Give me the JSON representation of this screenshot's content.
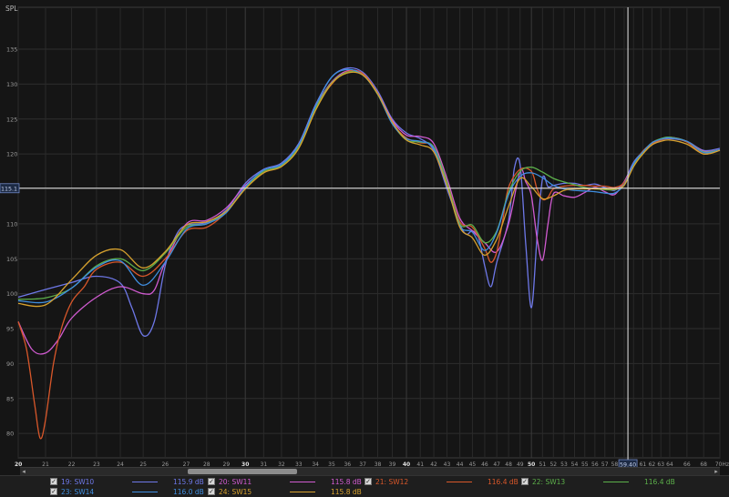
{
  "chart_data": {
    "type": "line",
    "ylabel": "SPL",
    "xunit": "Hz",
    "ylim": [
      76.5,
      141
    ],
    "xlim": [
      20,
      70
    ],
    "x_scale": "log",
    "yticks": [
      80,
      85,
      90,
      95,
      100,
      105,
      110,
      115,
      120,
      125,
      130,
      135
    ],
    "xticks": [
      20,
      21,
      22,
      23,
      24,
      25,
      26,
      27,
      28,
      29,
      30,
      31,
      32,
      33,
      34,
      35,
      36,
      37,
      38,
      39,
      40,
      41,
      42,
      43,
      44,
      45,
      46,
      47,
      48,
      49,
      50,
      51,
      52,
      53,
      54,
      55,
      56,
      57,
      58,
      59,
      60,
      61,
      62,
      63,
      64,
      66,
      68,
      70
    ],
    "xtick_labels": [
      "20",
      "21",
      "22",
      "23",
      "24",
      "25",
      "26",
      "27",
      "28",
      "29",
      "30",
      "31",
      "32",
      "33",
      "34",
      "35",
      "36",
      "37",
      "38",
      "39",
      "40",
      "41",
      "42",
      "43",
      "44",
      "45",
      "46",
      "47",
      "48",
      "49",
      "50",
      "51",
      "52",
      "53",
      "54",
      "55",
      "56",
      "57",
      "58",
      "59",
      "60",
      "61",
      "62",
      "63",
      "64",
      "66",
      "68",
      "70Hz"
    ],
    "grid": true,
    "cursor": {
      "x": 59.4,
      "y": 115.1,
      "x_label": "59.40",
      "y_label": "115.1"
    },
    "series": [
      {
        "name": "19: SW10",
        "level": "115.9 dB",
        "color": "#6e78e8",
        "x": [
          20,
          21,
          22,
          23,
          24,
          24.5,
          25,
          25.5,
          26,
          26.5,
          27,
          28,
          29,
          30,
          31,
          32,
          33,
          34,
          35,
          36,
          37,
          38,
          39,
          40,
          41,
          42,
          43,
          44,
          44.5,
          45,
          45.5,
          46,
          46.5,
          47,
          48,
          48.5,
          49,
          49.5,
          50,
          50.5,
          51,
          51.5,
          52,
          53,
          54,
          55,
          56,
          57,
          58,
          59,
          60,
          61,
          62,
          63,
          64,
          66,
          68,
          70
        ],
        "y": [
          99.5,
          100.6,
          101.6,
          102.5,
          101.5,
          98,
          94,
          96,
          104,
          108.3,
          109.8,
          110.2,
          112,
          115.8,
          117.8,
          118.7,
          121.5,
          127,
          131,
          132.3,
          131.7,
          129,
          125,
          123,
          122.2,
          120.5,
          115,
          110,
          108.5,
          109,
          108,
          104,
          101,
          104.5,
          110.5,
          118,
          118.4,
          107,
          98,
          108,
          116.5,
          115.3,
          115.5,
          115.8,
          115.8,
          115.5,
          115.7,
          115.2,
          114.8,
          116,
          118.8,
          120.3,
          121.3,
          122,
          122.2,
          121.8,
          120.5,
          120.8
        ]
      },
      {
        "name": "20: SW11",
        "level": "115.8 dB",
        "color": "#d15bd1",
        "x": [
          20,
          20.5,
          21,
          21.5,
          22,
          23,
          24,
          25,
          25.5,
          26,
          27,
          28,
          29,
          30,
          31,
          32,
          33,
          34,
          35,
          36,
          37,
          38,
          39,
          40,
          41,
          42,
          43,
          44,
          45,
          46,
          47,
          48,
          49,
          49.5,
          50,
          50.5,
          51,
          51.5,
          52,
          53,
          54,
          55,
          56,
          57,
          58,
          59,
          60,
          61,
          62,
          63,
          64,
          66,
          68,
          70
        ],
        "y": [
          96,
          92,
          91.5,
          93.5,
          96.5,
          99.5,
          101,
          100,
          100.5,
          104.5,
          110,
          110.5,
          112.3,
          115.5,
          117.5,
          118.4,
          121.3,
          126.7,
          130.3,
          131.9,
          131.5,
          128.7,
          124.8,
          122.7,
          122.5,
          121.5,
          116.5,
          110.8,
          109,
          107.3,
          106,
          110,
          117.5,
          116,
          114,
          108,
          104.8,
          110,
          114.3,
          114,
          113.8,
          114.5,
          115.2,
          114.6,
          114.2,
          116,
          118.5,
          120.1,
          121.6,
          122.1,
          122.4,
          121.8,
          120.4,
          120.6
        ]
      },
      {
        "name": "21: SW12",
        "level": "116.4 dB",
        "color": "#d8572a",
        "x": [
          20,
          20.3,
          20.6,
          20.8,
          21,
          21.3,
          21.6,
          22,
          22.5,
          23,
          24,
          25,
          26,
          27,
          28,
          29,
          30,
          31,
          32,
          33,
          34,
          35,
          36,
          37,
          38,
          39,
          40,
          41,
          42,
          43,
          44,
          45,
          46,
          46.5,
          47,
          47.5,
          48,
          49,
          50,
          50.5,
          51,
          51.5,
          52,
          53,
          54,
          55,
          56,
          57,
          58,
          59,
          60,
          61,
          62,
          63,
          64,
          66,
          68,
          70
        ],
        "y": [
          96,
          92,
          84,
          79.3,
          82,
          90,
          95,
          98.8,
          101,
          103.5,
          104.5,
          102.5,
          105,
          109,
          109.5,
          111.7,
          115.2,
          117.4,
          118.2,
          121,
          126.4,
          130,
          131.8,
          131.5,
          128.7,
          124.4,
          122.3,
          121.6,
          121,
          116,
          110.3,
          109.5,
          106.5,
          104.5,
          106,
          110.5,
          115.2,
          117.8,
          117.5,
          115,
          113.5,
          113.8,
          115,
          115.4,
          115.5,
          115.5,
          115.4,
          115.4,
          115.2,
          115.9,
          118.5,
          120.4,
          121.5,
          122,
          122.3,
          121.7,
          120,
          120.6
        ]
      },
      {
        "name": "22: SW13",
        "level": "116.4 dB",
        "color": "#5caf4a",
        "x": [
          20,
          21,
          22,
          23,
          24,
          25,
          26,
          27,
          28,
          29,
          30,
          31,
          32,
          33,
          34,
          35,
          36,
          37,
          38,
          39,
          40,
          41,
          42,
          43,
          44,
          45,
          46,
          47,
          48,
          49,
          50,
          51,
          52,
          53,
          54,
          55,
          56,
          57,
          58,
          59,
          60,
          61,
          62,
          63,
          64,
          66,
          68,
          70
        ],
        "y": [
          99.2,
          99.4,
          100.8,
          104,
          105,
          103.3,
          105.8,
          109.5,
          110,
          111.8,
          115.2,
          117.5,
          118.3,
          121,
          126.5,
          130.2,
          131.7,
          131.3,
          128.5,
          124.4,
          122,
          121.7,
          121,
          116,
          110,
          109.8,
          107.3,
          109,
          114.5,
          117.5,
          118.1,
          117.4,
          116.5,
          116,
          115.6,
          115.2,
          115,
          114.9,
          114.9,
          115.6,
          118.3,
          120.2,
          121.6,
          122.2,
          122.4,
          121.8,
          120.3,
          120.6
        ]
      },
      {
        "name": "23: SW14",
        "level": "116.0 dB",
        "color": "#3f8ee0",
        "x": [
          20,
          21,
          22,
          23,
          24,
          25,
          26,
          27,
          28,
          29,
          30,
          31,
          32,
          33,
          34,
          35,
          36,
          37,
          38,
          39,
          40,
          41,
          42,
          43,
          44,
          45,
          46,
          47,
          48,
          49,
          50,
          51,
          52,
          53,
          54,
          55,
          56,
          57,
          58,
          59,
          60,
          61,
          62,
          63,
          64,
          66,
          68,
          70
        ],
        "y": [
          99,
          98.8,
          100.8,
          103.8,
          104.7,
          101.2,
          104.5,
          109.2,
          110,
          111.6,
          115.3,
          117.7,
          118.5,
          121.3,
          126.8,
          131,
          132.1,
          131.3,
          128.6,
          124.3,
          122.2,
          121.8,
          120.8,
          115.5,
          109.7,
          108.8,
          106.2,
          108.8,
          114.2,
          116.8,
          117.3,
          116.6,
          115.5,
          115,
          114.8,
          114.7,
          114.6,
          114.4,
          114.4,
          115.6,
          118.6,
          120.3,
          121.6,
          122.1,
          122.3,
          121.8,
          120.2,
          120.6
        ]
      },
      {
        "name": "24: SW15",
        "level": "115.8 dB",
        "color": "#d6a12e",
        "x": [
          20,
          21,
          22,
          23,
          24,
          25,
          26,
          27,
          28,
          29,
          30,
          31,
          32,
          33,
          34,
          35,
          36,
          37,
          38,
          39,
          40,
          41,
          42,
          43,
          44,
          45,
          46,
          47,
          48,
          49,
          50,
          51,
          52,
          53,
          54,
          55,
          56,
          57,
          58,
          59,
          60,
          61,
          62,
          63,
          64,
          66,
          68,
          70
        ],
        "y": [
          98.6,
          98.4,
          102,
          105.5,
          106.3,
          103.7,
          106,
          109.8,
          110.3,
          111.8,
          115,
          117.3,
          118.2,
          120.8,
          126.2,
          130.1,
          131.6,
          131.3,
          128.6,
          124.6,
          122,
          121.3,
          120.3,
          115.5,
          109.5,
          108,
          105.5,
          107.8,
          112.5,
          116.5,
          115.3,
          113.6,
          114,
          114.8,
          115,
          115,
          115,
          115,
          115,
          115.5,
          118.2,
          120,
          121.3,
          121.8,
          122,
          121.4,
          120,
          120.5
        ]
      }
    ]
  },
  "ui": {
    "scroll_left": "◂",
    "scroll_right": "▸",
    "check": "✓"
  }
}
